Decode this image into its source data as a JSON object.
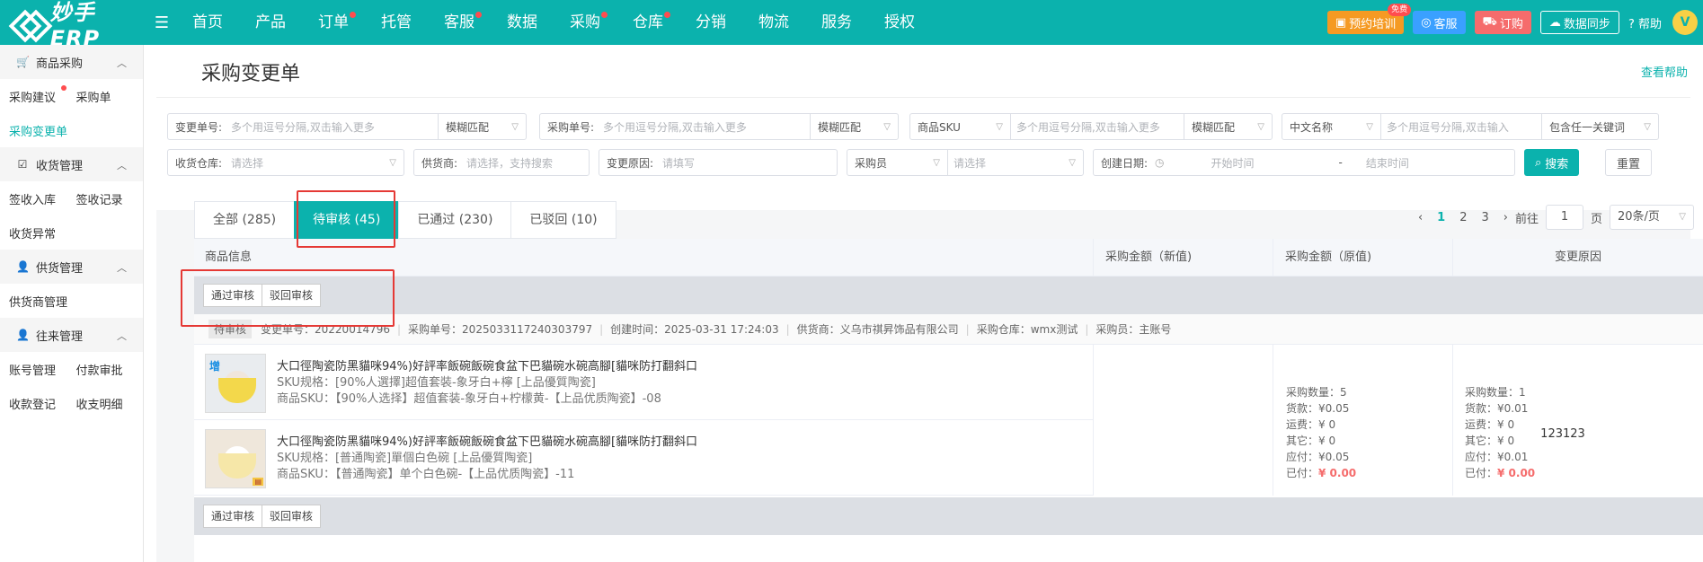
{
  "app": {
    "logo": "妙手ERP"
  },
  "nav": [
    {
      "label": "首页",
      "dot": false
    },
    {
      "label": "产品",
      "dot": false
    },
    {
      "label": "订单",
      "dot": true
    },
    {
      "label": "托管",
      "dot": false
    },
    {
      "label": "客服",
      "dot": true
    },
    {
      "label": "数据",
      "dot": false
    },
    {
      "label": "采购",
      "dot": true
    },
    {
      "label": "仓库",
      "dot": true
    },
    {
      "label": "分销",
      "dot": false
    },
    {
      "label": "物流",
      "dot": false
    },
    {
      "label": "服务",
      "dot": false
    },
    {
      "label": "授权",
      "dot": false
    }
  ],
  "topbar": {
    "training": "预约培训",
    "free_badge": "免费",
    "service": "客服",
    "buy": "订购",
    "sync": "数据同步",
    "help": "帮助",
    "avatar": "V"
  },
  "sidebar": {
    "groups": [
      {
        "title": "商品采购",
        "icon": "cart-icon",
        "items": [
          {
            "label": "采购建议",
            "dot": true,
            "active": false
          },
          {
            "label": "采购单",
            "dot": false,
            "active": false
          },
          {
            "label": "采购变更单",
            "dot": false,
            "active": true
          }
        ]
      },
      {
        "title": "收货管理",
        "icon": "checkbox-icon",
        "items": [
          {
            "label": "签收入库",
            "dot": false,
            "active": false
          },
          {
            "label": "签收记录",
            "dot": false,
            "active": false
          },
          {
            "label": "收货异常",
            "dot": false,
            "active": false
          }
        ]
      },
      {
        "title": "供货管理",
        "icon": "user-gear-icon",
        "items": [
          {
            "label": "供货商管理",
            "dot": false,
            "active": false
          }
        ]
      },
      {
        "title": "往来管理",
        "icon": "person-icon",
        "items": [
          {
            "label": "账号管理",
            "dot": false,
            "active": false
          },
          {
            "label": "付款审批",
            "dot": false,
            "active": false
          },
          {
            "label": "收款登记",
            "dot": false,
            "active": false
          },
          {
            "label": "收支明细",
            "dot": false,
            "active": false
          }
        ]
      }
    ]
  },
  "page": {
    "title": "采购变更单",
    "help_link": "查看帮助"
  },
  "filters": {
    "change_no": {
      "label": "变更单号:",
      "placeholder": "多个用逗号分隔,双击输入更多",
      "match": "模糊匹配"
    },
    "purchase_no": {
      "label": "采购单号:",
      "placeholder": "多个用逗号分隔,双击输入更多",
      "match": "模糊匹配"
    },
    "sku": {
      "label": "商品SKU",
      "placeholder": "多个用逗号分隔,双击输入更多",
      "match": "模糊匹配"
    },
    "cn_name": {
      "label": "中文名称",
      "placeholder": "多个用逗号分隔,双击输入",
      "match": "包含任一关键词"
    },
    "warehouse": {
      "label": "收货仓库:",
      "placeholder": "请选择"
    },
    "supplier": {
      "label": "供货商:",
      "placeholder": "请选择，支持搜索"
    },
    "reason": {
      "label": "变更原因:",
      "placeholder": "请填写"
    },
    "buyer": {
      "label": "采购员",
      "placeholder": "请选择"
    },
    "date": {
      "label": "创建日期:",
      "start": "开始时间",
      "dash": "-",
      "end": "结束时间"
    },
    "search": "搜索",
    "reset": "重置"
  },
  "tabs": [
    {
      "label": "全部 (285)",
      "active": false
    },
    {
      "label": "待审核 (45)",
      "active": true
    },
    {
      "label": "已通过 (230)",
      "active": false
    },
    {
      "label": "已驳回 (10)",
      "active": false
    }
  ],
  "pager": {
    "prev": "‹",
    "pages": [
      "1",
      "2",
      "3"
    ],
    "next": "›",
    "goto": "前往",
    "current": "1",
    "page_unit": "页",
    "size": "20条/页"
  },
  "table": {
    "headers": [
      "商品信息",
      "采购金额（新值)",
      "采购金额（原值)",
      "变更原因"
    ],
    "approve": "通过审核",
    "reject": "驳回审核",
    "order": {
      "status": "待审核",
      "change_no": "变更单号：20220014796",
      "purchase_no": "采购单号：2025033117240303797",
      "created": "创建时间：2025-03-31 17:24:03",
      "supplier": "供货商：义乌市祺昇饰品有限公司",
      "warehouse": "采购仓库：wmx测试",
      "buyer": "采购员：主账号"
    },
    "products": [
      {
        "badge": "增",
        "name": "大口徑陶瓷防黑貓咪94%)好評率飯碗飯碗食盆下巴貓碗水碗高腳[貓咪防打翻斜口",
        "spec": "SKU规格：[90%人選擇]超值套裝-象牙白+檸 [上品優質陶瓷]",
        "sku": "商品SKU：【90%人选择】超值套装-象牙白+柠檬黄-【上品优质陶瓷】-08"
      },
      {
        "badge": "",
        "name": "大口徑陶瓷防黑貓咪94%)好評率飯碗飯碗食盆下巴貓碗水碗高腳[貓咪防打翻斜口",
        "spec": "SKU规格：[普通陶瓷]單個白色碗 [上品優質陶瓷]",
        "sku": "商品SKU：【普通陶瓷】单个白色碗-【上品优质陶瓷】-11"
      }
    ],
    "new_amount": [
      "采购数量：5",
      "货款：¥0.05",
      "运费：¥ 0",
      "其它：¥ 0",
      "应付：¥0.05"
    ],
    "new_paid_label": "已付：",
    "new_paid_value": "¥ 0.00",
    "old_amount": [
      "采购数量：1",
      "货款：¥0.01",
      "运费：¥ 0",
      "其它：¥ 0",
      "应付：¥0.01"
    ],
    "old_paid_label": "已付：",
    "old_paid_value": "¥ 0.00",
    "reason": "123123"
  }
}
